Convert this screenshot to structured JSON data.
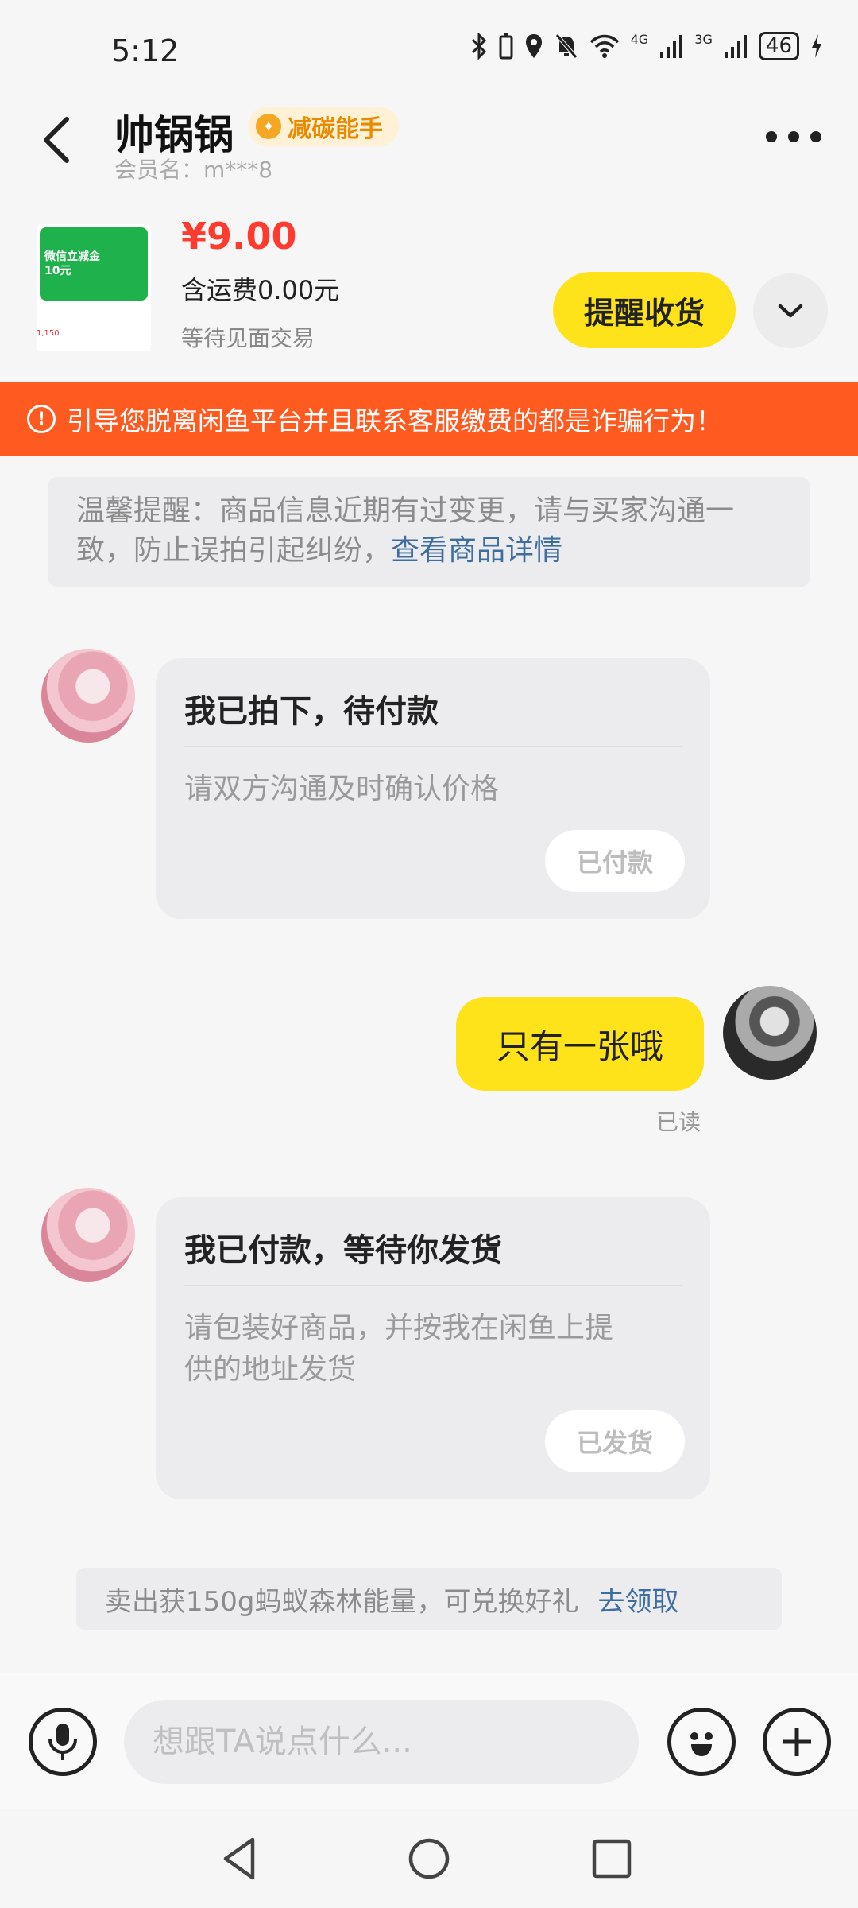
{
  "status_bar": {
    "time": "5:12",
    "network_a": "4G",
    "network_b": "3G",
    "battery": "46"
  },
  "header": {
    "title": "帅锅锅",
    "badge": "减碳能手",
    "member": "会员名：m***8"
  },
  "product": {
    "thumb_text_1": "微信立减金",
    "thumb_text_2": "10元",
    "thumb_foot": "1,150",
    "price": "¥9.00",
    "shipping": "含运费0.00元",
    "trade_status": "等待见面交易",
    "remind_label": "提醒收货"
  },
  "warning": {
    "text": "引导您脱离闲鱼平台并且联系客服缴费的都是诈骗行为！"
  },
  "notice": {
    "text": "温馨提醒：商品信息近期有过变更，请与买家沟通一致，防止误拍引起纠纷，",
    "link": "查看商品详情"
  },
  "messages": {
    "card1": {
      "title": "我已拍下，待付款",
      "desc": "请双方沟通及时确认价格",
      "button": "已付款"
    },
    "bubble": {
      "text": "只有一张哦",
      "status": "已读"
    },
    "card2": {
      "title": "我已付款，等待你发货",
      "desc_1": "请包装好商品，并按我在闲鱼上提",
      "desc_2": "供的地址发货",
      "button": "已发货"
    }
  },
  "energy": {
    "text": "卖出获150g蚂蚁森林能量，可兑换好礼",
    "link": "去领取"
  },
  "input": {
    "placeholder": "想跟TA说点什么..."
  },
  "colors": {
    "accent": "#ffe31a",
    "warning": "#ff5a1f",
    "price": "#ff3b30",
    "link": "#3e6ea0"
  }
}
